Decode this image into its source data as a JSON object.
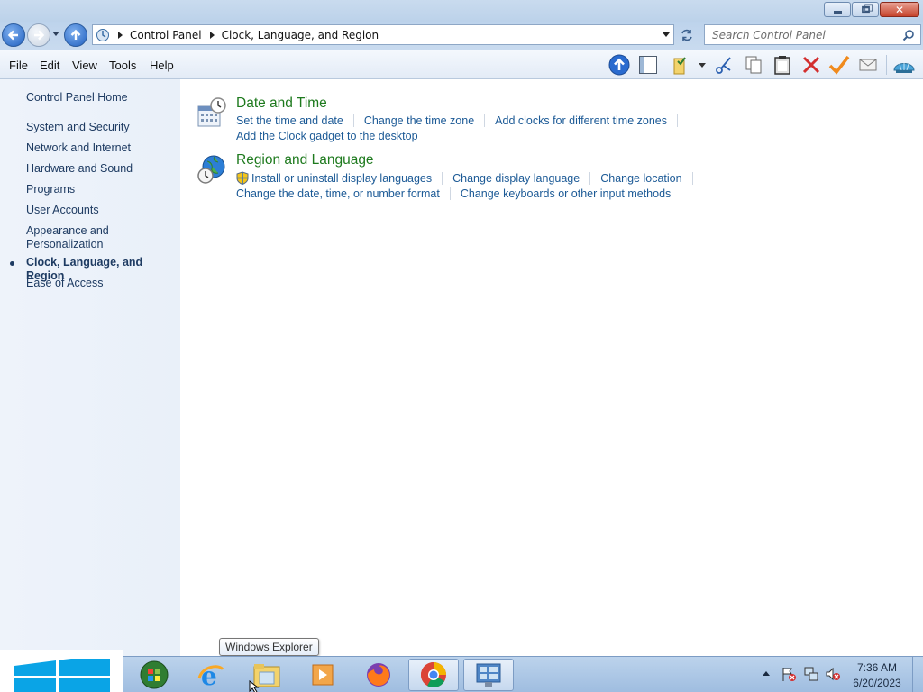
{
  "window": {
    "minimize_icon": "minimize-icon",
    "restore_icon": "restore-icon",
    "close_icon": "close-icon"
  },
  "address_bar": {
    "breadcrumbs": [
      "Control Panel",
      "Clock, Language, and Region"
    ],
    "search_placeholder": "Search Control Panel"
  },
  "menu": {
    "items": [
      "File",
      "Edit",
      "View",
      "Tools",
      "Help"
    ]
  },
  "left_pane": {
    "home": "Control Panel Home",
    "items": [
      "System and Security",
      "Network and Internet",
      "Hardware and Sound",
      "Programs",
      "User Accounts",
      "Appearance and Personalization",
      "Clock, Language, and Region",
      "Ease of Access"
    ],
    "appearance_line1": "Appearance and",
    "appearance_line2": "Personalization",
    "current": "Clock, Language, and Region"
  },
  "categories": [
    {
      "title": "Date and Time",
      "icon": "clock-calendar-icon",
      "tasks_row1": [
        "Set the time and date",
        "Change the time zone",
        "Add clocks for different time zones"
      ],
      "tasks_row2": [
        "Add the Clock gadget to the desktop"
      ]
    },
    {
      "title": "Region and Language",
      "icon": "globe-clock-icon",
      "tasks_row1": [
        "Install or uninstall display languages",
        "Change display language",
        "Change location"
      ],
      "tasks_row2": [
        "Change the date, time, or number format",
        "Change keyboards or other input methods"
      ]
    }
  ],
  "taskbar": {
    "tooltip": "Windows Explorer",
    "time": "7:36 AM",
    "date": "6/20/2023",
    "apps": [
      "start-orb-icon",
      "internet-explorer-icon",
      "windows-explorer-icon",
      "media-player-icon",
      "firefox-icon",
      "chrome-icon",
      "control-panel-icon"
    ]
  },
  "colors": {
    "category_title": "#1e7a1e",
    "task_link": "#1c5a96",
    "left_link": "#1e3b62",
    "close_button": "#c6442c"
  }
}
